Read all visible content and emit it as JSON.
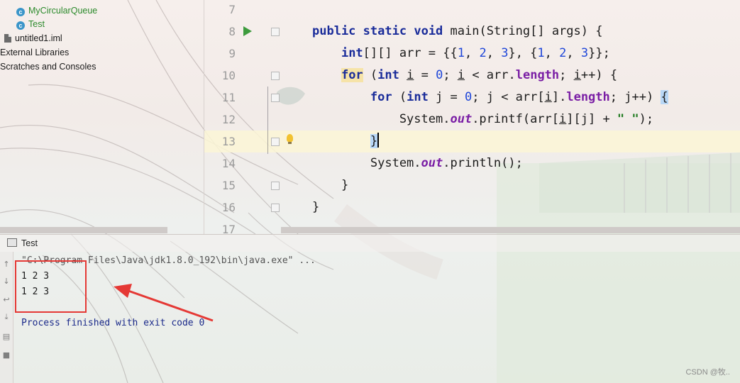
{
  "project_tree": {
    "items": [
      {
        "label": "MyCircularQueue",
        "type": "class"
      },
      {
        "label": "Test",
        "type": "class"
      },
      {
        "label": "untitled1.iml",
        "type": "file"
      },
      {
        "label": "External Libraries",
        "type": "folder"
      },
      {
        "label": "Scratches and Consoles",
        "type": "folder"
      }
    ]
  },
  "editor": {
    "line_numbers": [
      "7",
      "8",
      "9",
      "10",
      "11",
      "12",
      "13",
      "14",
      "15",
      "16",
      "17"
    ],
    "current_line": "13"
  },
  "run_panel": {
    "tab_label": "Test",
    "command": "\"C:\\Program Files\\Java\\jdk1.8.0_192\\bin\\java.exe\" ...",
    "output": [
      "1 2 3",
      "1 2 3"
    ],
    "finished": "Process finished with exit code 0"
  },
  "watermark": "CSDN @牧..",
  "icons": [
    "class-icon",
    "file-icon",
    "run-gutter-icon",
    "fold-icon",
    "intention-bulb-icon",
    "run-tab-icon",
    "rerun-icon",
    "scroll-up-icon",
    "scroll-down-icon",
    "soft-wrap-icon",
    "scroll-to-end-icon",
    "print-icon",
    "trash-icon"
  ],
  "colors": {
    "annotation": "#e53935",
    "keyword": "#1a2c9a",
    "number": "#1e46d9",
    "string": "#1f7a1f",
    "field": "#7a1ea5"
  }
}
